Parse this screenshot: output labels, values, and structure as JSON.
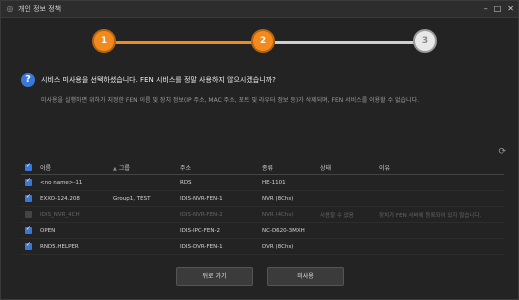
{
  "window": {
    "title": "개인 정보 정책",
    "controls": [
      "–",
      "□",
      "✕"
    ]
  },
  "stepper": {
    "steps": [
      "1",
      "2",
      "3"
    ],
    "active": 2
  },
  "question": "시비스 미사용을 선택하셨습니다. FEN 시비스를 정말 사용하지 않으시겠습니까?",
  "description": "미사용을 실행하면 위하가 지정한 FEN 이름 및 장치 정보(IP 주소, MAC 주소, 포트 및 라우터 정보 등)가 삭제되며, FEN 서비스를 이용할 수 없습니다.",
  "table": {
    "headers": {
      "name": "이름",
      "group": "그룹",
      "address": "주소",
      "type": "종류",
      "status": "상태",
      "reason": "이유"
    },
    "rows": [
      {
        "name": "<no name>-11",
        "group": "",
        "address": "RDS",
        "type": "HE-1101",
        "status": "",
        "reason": "",
        "checked": true,
        "disabled": false
      },
      {
        "name": "EXXO-124.208",
        "group": "Group1, TEST",
        "address": "IDIS-NVR-FEN-1",
        "type": "NVR (8Chs)",
        "status": "",
        "reason": "",
        "checked": true,
        "disabled": false
      },
      {
        "name": "IDIS_NVR_4CH",
        "group": "",
        "address": "IDIS-NVR-FEN-2",
        "type": "NVR (4Chs)",
        "status": "사용할 수 없음",
        "reason": "장치가 FEN 서버에 등록되어 있지 않습니다.",
        "checked": false,
        "disabled": true
      },
      {
        "name": "OPEN",
        "group": "",
        "address": "IDIS-IPC-FEN-2",
        "type": "NC-D620-3MXH",
        "status": "",
        "reason": "",
        "checked": true,
        "disabled": false
      },
      {
        "name": "RND5.HELPER",
        "group": "",
        "address": "IDIS-DVR-FEN-1",
        "type": "DVR (8Chs)",
        "status": "",
        "reason": "",
        "checked": true,
        "disabled": false
      }
    ]
  },
  "buttons": {
    "back": "뒤로 가기",
    "skip": "미사용"
  },
  "colors": {
    "accent": "#f28a1e",
    "checkbox": "#3a78d8",
    "background": "#232323"
  }
}
